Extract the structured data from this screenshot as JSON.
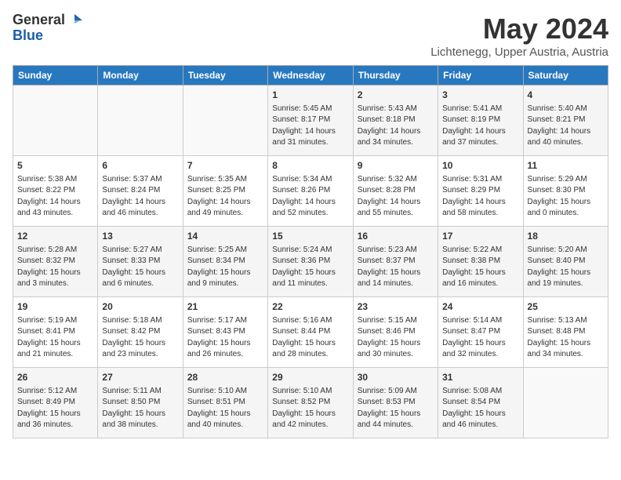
{
  "header": {
    "logo_general": "General",
    "logo_blue": "Blue",
    "month": "May 2024",
    "location": "Lichtenegg, Upper Austria, Austria"
  },
  "weekdays": [
    "Sunday",
    "Monday",
    "Tuesday",
    "Wednesday",
    "Thursday",
    "Friday",
    "Saturday"
  ],
  "weeks": [
    [
      {
        "day": "",
        "sunrise": "",
        "sunset": "",
        "daylight": ""
      },
      {
        "day": "",
        "sunrise": "",
        "sunset": "",
        "daylight": ""
      },
      {
        "day": "",
        "sunrise": "",
        "sunset": "",
        "daylight": ""
      },
      {
        "day": "1",
        "sunrise": "Sunrise: 5:45 AM",
        "sunset": "Sunset: 8:17 PM",
        "daylight": "Daylight: 14 hours and 31 minutes."
      },
      {
        "day": "2",
        "sunrise": "Sunrise: 5:43 AM",
        "sunset": "Sunset: 8:18 PM",
        "daylight": "Daylight: 14 hours and 34 minutes."
      },
      {
        "day": "3",
        "sunrise": "Sunrise: 5:41 AM",
        "sunset": "Sunset: 8:19 PM",
        "daylight": "Daylight: 14 hours and 37 minutes."
      },
      {
        "day": "4",
        "sunrise": "Sunrise: 5:40 AM",
        "sunset": "Sunset: 8:21 PM",
        "daylight": "Daylight: 14 hours and 40 minutes."
      }
    ],
    [
      {
        "day": "5",
        "sunrise": "Sunrise: 5:38 AM",
        "sunset": "Sunset: 8:22 PM",
        "daylight": "Daylight: 14 hours and 43 minutes."
      },
      {
        "day": "6",
        "sunrise": "Sunrise: 5:37 AM",
        "sunset": "Sunset: 8:24 PM",
        "daylight": "Daylight: 14 hours and 46 minutes."
      },
      {
        "day": "7",
        "sunrise": "Sunrise: 5:35 AM",
        "sunset": "Sunset: 8:25 PM",
        "daylight": "Daylight: 14 hours and 49 minutes."
      },
      {
        "day": "8",
        "sunrise": "Sunrise: 5:34 AM",
        "sunset": "Sunset: 8:26 PM",
        "daylight": "Daylight: 14 hours and 52 minutes."
      },
      {
        "day": "9",
        "sunrise": "Sunrise: 5:32 AM",
        "sunset": "Sunset: 8:28 PM",
        "daylight": "Daylight: 14 hours and 55 minutes."
      },
      {
        "day": "10",
        "sunrise": "Sunrise: 5:31 AM",
        "sunset": "Sunset: 8:29 PM",
        "daylight": "Daylight: 14 hours and 58 minutes."
      },
      {
        "day": "11",
        "sunrise": "Sunrise: 5:29 AM",
        "sunset": "Sunset: 8:30 PM",
        "daylight": "Daylight: 15 hours and 0 minutes."
      }
    ],
    [
      {
        "day": "12",
        "sunrise": "Sunrise: 5:28 AM",
        "sunset": "Sunset: 8:32 PM",
        "daylight": "Daylight: 15 hours and 3 minutes."
      },
      {
        "day": "13",
        "sunrise": "Sunrise: 5:27 AM",
        "sunset": "Sunset: 8:33 PM",
        "daylight": "Daylight: 15 hours and 6 minutes."
      },
      {
        "day": "14",
        "sunrise": "Sunrise: 5:25 AM",
        "sunset": "Sunset: 8:34 PM",
        "daylight": "Daylight: 15 hours and 9 minutes."
      },
      {
        "day": "15",
        "sunrise": "Sunrise: 5:24 AM",
        "sunset": "Sunset: 8:36 PM",
        "daylight": "Daylight: 15 hours and 11 minutes."
      },
      {
        "day": "16",
        "sunrise": "Sunrise: 5:23 AM",
        "sunset": "Sunset: 8:37 PM",
        "daylight": "Daylight: 15 hours and 14 minutes."
      },
      {
        "day": "17",
        "sunrise": "Sunrise: 5:22 AM",
        "sunset": "Sunset: 8:38 PM",
        "daylight": "Daylight: 15 hours and 16 minutes."
      },
      {
        "day": "18",
        "sunrise": "Sunrise: 5:20 AM",
        "sunset": "Sunset: 8:40 PM",
        "daylight": "Daylight: 15 hours and 19 minutes."
      }
    ],
    [
      {
        "day": "19",
        "sunrise": "Sunrise: 5:19 AM",
        "sunset": "Sunset: 8:41 PM",
        "daylight": "Daylight: 15 hours and 21 minutes."
      },
      {
        "day": "20",
        "sunrise": "Sunrise: 5:18 AM",
        "sunset": "Sunset: 8:42 PM",
        "daylight": "Daylight: 15 hours and 23 minutes."
      },
      {
        "day": "21",
        "sunrise": "Sunrise: 5:17 AM",
        "sunset": "Sunset: 8:43 PM",
        "daylight": "Daylight: 15 hours and 26 minutes."
      },
      {
        "day": "22",
        "sunrise": "Sunrise: 5:16 AM",
        "sunset": "Sunset: 8:44 PM",
        "daylight": "Daylight: 15 hours and 28 minutes."
      },
      {
        "day": "23",
        "sunrise": "Sunrise: 5:15 AM",
        "sunset": "Sunset: 8:46 PM",
        "daylight": "Daylight: 15 hours and 30 minutes."
      },
      {
        "day": "24",
        "sunrise": "Sunrise: 5:14 AM",
        "sunset": "Sunset: 8:47 PM",
        "daylight": "Daylight: 15 hours and 32 minutes."
      },
      {
        "day": "25",
        "sunrise": "Sunrise: 5:13 AM",
        "sunset": "Sunset: 8:48 PM",
        "daylight": "Daylight: 15 hours and 34 minutes."
      }
    ],
    [
      {
        "day": "26",
        "sunrise": "Sunrise: 5:12 AM",
        "sunset": "Sunset: 8:49 PM",
        "daylight": "Daylight: 15 hours and 36 minutes."
      },
      {
        "day": "27",
        "sunrise": "Sunrise: 5:11 AM",
        "sunset": "Sunset: 8:50 PM",
        "daylight": "Daylight: 15 hours and 38 minutes."
      },
      {
        "day": "28",
        "sunrise": "Sunrise: 5:10 AM",
        "sunset": "Sunset: 8:51 PM",
        "daylight": "Daylight: 15 hours and 40 minutes."
      },
      {
        "day": "29",
        "sunrise": "Sunrise: 5:10 AM",
        "sunset": "Sunset: 8:52 PM",
        "daylight": "Daylight: 15 hours and 42 minutes."
      },
      {
        "day": "30",
        "sunrise": "Sunrise: 5:09 AM",
        "sunset": "Sunset: 8:53 PM",
        "daylight": "Daylight: 15 hours and 44 minutes."
      },
      {
        "day": "31",
        "sunrise": "Sunrise: 5:08 AM",
        "sunset": "Sunset: 8:54 PM",
        "daylight": "Daylight: 15 hours and 46 minutes."
      },
      {
        "day": "",
        "sunrise": "",
        "sunset": "",
        "daylight": ""
      }
    ]
  ]
}
